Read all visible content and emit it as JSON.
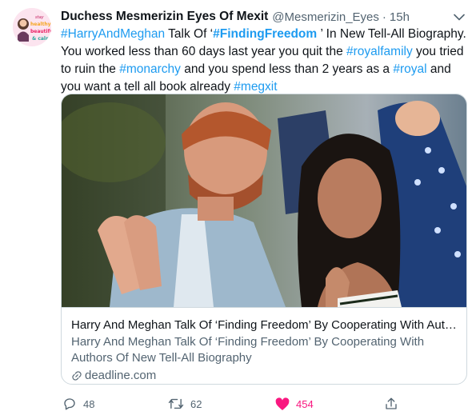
{
  "tweet": {
    "display_name": "Duchess Mesmerizin Eyes Of Mexit",
    "handle": "@Mesmerizin_Eyes",
    "separator": "·",
    "time": "15h",
    "avatar": {
      "icon": "avatar-illustration",
      "lettering": [
        "stay",
        "healthy",
        "beautiful",
        "& calm"
      ]
    },
    "text_parts": {
      "h1": "#HarryAndMeghan",
      "t1": " Talk Of ‘",
      "h2": "#FindingFreedom",
      "t2": " ’ In New Tell-All Biography. You worked less than 60 days last year you quit the ",
      "h3": "#royalfamily",
      "t3": " you tried to ruin the ",
      "h4": "#monarchy",
      "t4": " and you spend less than 2 years as a ",
      "h5": "#royal",
      "t5": " and you want a tell all book already ",
      "h6": "#megxit"
    }
  },
  "card": {
    "image_icon": "photo",
    "title": "Harry And Meghan Talk Of ‘Finding Freedom’ By Cooperating With Authors Of New Tell-All Biography",
    "description": "Harry And Meghan Talk Of ‘Finding Freedom’ By Cooperating With Authors Of New Tell-All Biography",
    "domain": "deadline.com",
    "domain_icon": "link-icon"
  },
  "actions": {
    "reply_count": "48",
    "retweet_count": "62",
    "like_count": "454",
    "icons": [
      "reply-icon",
      "retweet-icon",
      "heart-icon",
      "share-icon"
    ]
  },
  "colors": {
    "link": "#1d9bf0",
    "secondary_text": "#536471",
    "like": "#f91880",
    "border": "#cfd9de"
  }
}
